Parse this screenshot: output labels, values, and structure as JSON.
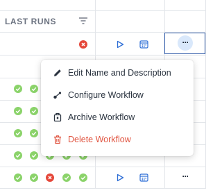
{
  "header": {
    "column_title": "LAST RUNS"
  },
  "rows": [
    {
      "statuses": [
        "fail"
      ]
    },
    {
      "statuses": []
    },
    {
      "statuses": [
        "ok",
        "ok",
        "ok"
      ]
    },
    {
      "statuses": [
        "ok",
        "ok",
        "ok"
      ]
    },
    {
      "statuses": [
        "ok",
        "ok",
        "ok"
      ]
    },
    {
      "statuses": [
        "ok",
        "ok",
        "ok",
        "ok",
        "ok"
      ]
    },
    {
      "statuses": [
        "ok",
        "ok",
        "fail",
        "ok",
        "ok"
      ]
    }
  ],
  "more_label": "···",
  "context_menu": {
    "items": [
      {
        "label": "Edit Name and Description",
        "icon": "pencil-icon"
      },
      {
        "label": "Configure Workflow",
        "icon": "configure-icon"
      },
      {
        "label": "Archive Workflow",
        "icon": "archive-icon"
      },
      {
        "label": "Delete Workflow",
        "icon": "trash-icon"
      }
    ]
  },
  "colors": {
    "ok": "#8bd36a",
    "fail": "#e5483b",
    "accent": "#2f6fd6",
    "danger": "#e0533f",
    "selected_cell_border": "#2f5aa8"
  }
}
